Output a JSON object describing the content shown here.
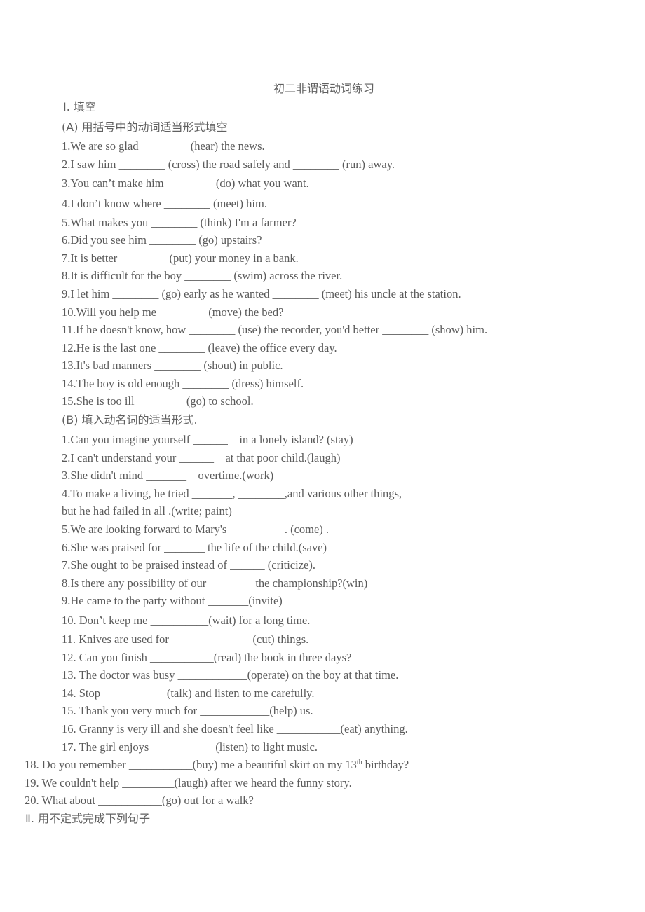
{
  "document": {
    "title": "初二非谓语动词练习",
    "section1_heading": "Ⅰ. 填空",
    "partA_heading": "(A) 用括号中的动词适当形式填空",
    "partA_items": [
      "1.We are so glad ________ (hear) the news.",
      "2.I saw him ________ (cross) the road safely and ________ (run) away.",
      "3.You can’t make him ________ (do) what you want.",
      "4.I don’t know where ________ (meet) him.",
      "5.What makes you ________ (think) I'm a farmer?",
      "6.Did you see him ________ (go) upstairs?",
      "7.It is better ________ (put) your money in a bank.",
      "8.It is difficult for the boy ________ (swim) across the river.",
      "9.I let him ________ (go) early as he wanted ________ (meet) his uncle at the station.",
      "10.Will you help me ________ (move) the bed?",
      "11.If he doesn't know, how ________ (use) the recorder, you'd better ________ (show) him.",
      "12.He is the last one ________ (leave) the office every day.",
      "13.It's bad manners ________ (shout) in public.",
      "14.The boy is old enough ________ (dress) himself.",
      "15.She is too ill ________ (go) to school."
    ],
    "partB_heading": "(B) 填入动名词的适当形式.",
    "partB_items": [
      "1.Can you imagine yourself ______    in a lonely island? (stay)",
      "2.I can't understand your ______    at that poor child.(laugh)",
      "3.She didn't mind _______    overtime.(work)",
      "4.To make a living, he tried _______, ________,and various other things,",
      "but he had failed in all .(write; paint)",
      "5.We are looking forward to Mary's________    . (come) .",
      "6.She was praised for _______ the life of the child.(save)",
      "7.She ought to be praised instead of ______ (criticize).",
      "8.Is there any possibility of our ______    the championship?(win)",
      "9.He came to the party without _______(invite)",
      "10. Don’t keep me __________(wait) for a long time.",
      "11. Knives are used for ______________(cut) things.",
      "12. Can you finish ___________(read) the book in three days?",
      "13. The doctor was busy ____________(operate) on the boy at that time.",
      "14. Stop ___________(talk) and listen to me carefully.",
      "15. Thank you very much for ____________(help) us.",
      "16. Granny is very ill and she doesn't feel like ___________(eat) anything.",
      "17. The girl enjoys ___________(listen) to light music."
    ],
    "partB_outdented_items": [
      {
        "before": "18. Do you remember ___________(buy) me a beautiful skirt on my 13",
        "sup": "th",
        "after": " birthday?"
      },
      {
        "before": "19. We couldn't help _________(laugh) after we heard the funny story.",
        "sup": "",
        "after": ""
      },
      {
        "before": "20. What about ___________(go) out for a walk?",
        "sup": "",
        "after": ""
      }
    ],
    "section2_heading": "Ⅱ. 用不定式完成下列句子"
  }
}
